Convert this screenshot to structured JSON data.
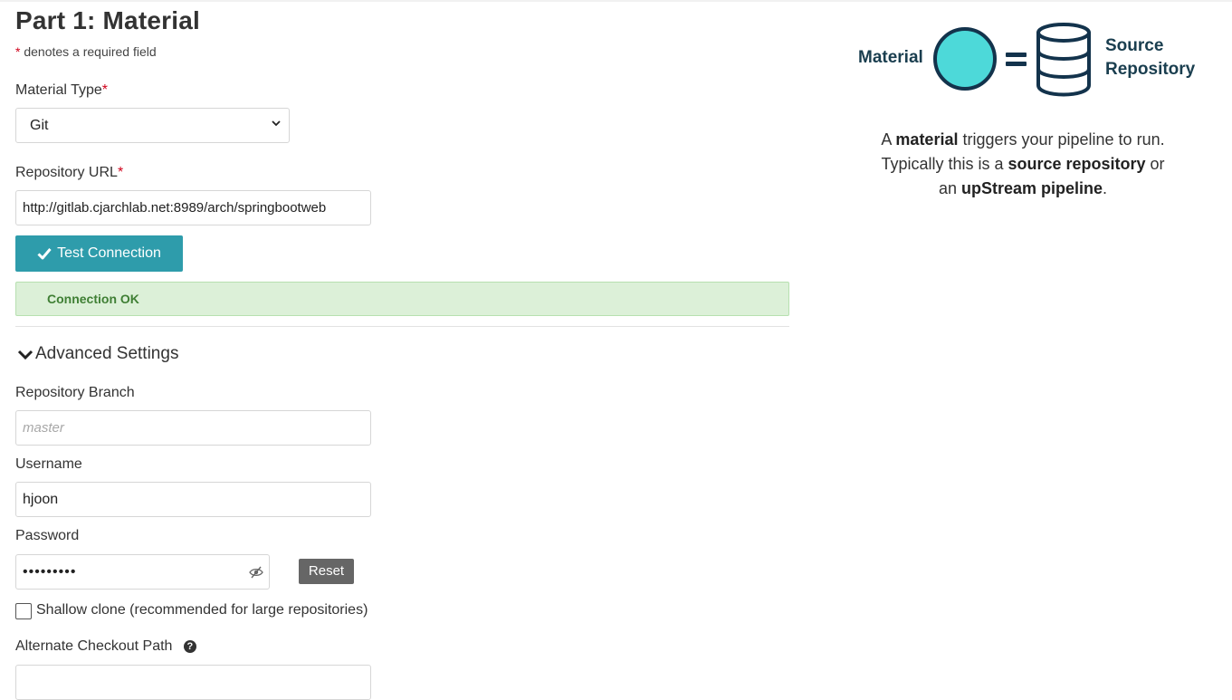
{
  "header": {
    "title": "Part 1: Material",
    "required_star": "*",
    "required_note": "denotes a required field"
  },
  "form": {
    "material_type_label": "Material Type",
    "material_type_value": "Git",
    "repo_url_label": "Repository URL",
    "repo_url_value": "http://gitlab.cjarchlab.net:8989/arch/springbootweb",
    "test_button_label": "Test Connection",
    "connection_status": "Connection OK",
    "advanced_label": "Advanced Settings",
    "branch_label": "Repository Branch",
    "branch_placeholder": "master",
    "username_label": "Username",
    "username_value": "hjoon",
    "password_label": "Password",
    "password_value": "•••••••••",
    "reset_button_label": "Reset",
    "shallow_clone_label": "Shallow clone (recommended for large repositories)",
    "shallow_clone_checked": false,
    "alt_checkout_label": "Alternate Checkout Path",
    "alt_checkout_value": ""
  },
  "illustration": {
    "left_label": "Material",
    "right_label_line1": "Source",
    "right_label_line2": "Repository",
    "circle_color": "#4dd9d9",
    "stroke_color": "#13334c"
  },
  "description": {
    "l1_a": "A ",
    "l1_b": "material",
    "l1_c": " triggers your pipeline to run.",
    "l2_a": "Typically this is a ",
    "l2_b": "source repository",
    "l2_c": " or",
    "l3_a": "an ",
    "l3_b": "upStream pipeline",
    "l3_c": "."
  },
  "colors": {
    "accent": "#2e9cab",
    "success_bg": "#dcf0d8",
    "success_text": "#3f7f34",
    "required": "#d0021b",
    "reset_bg": "#666666"
  }
}
